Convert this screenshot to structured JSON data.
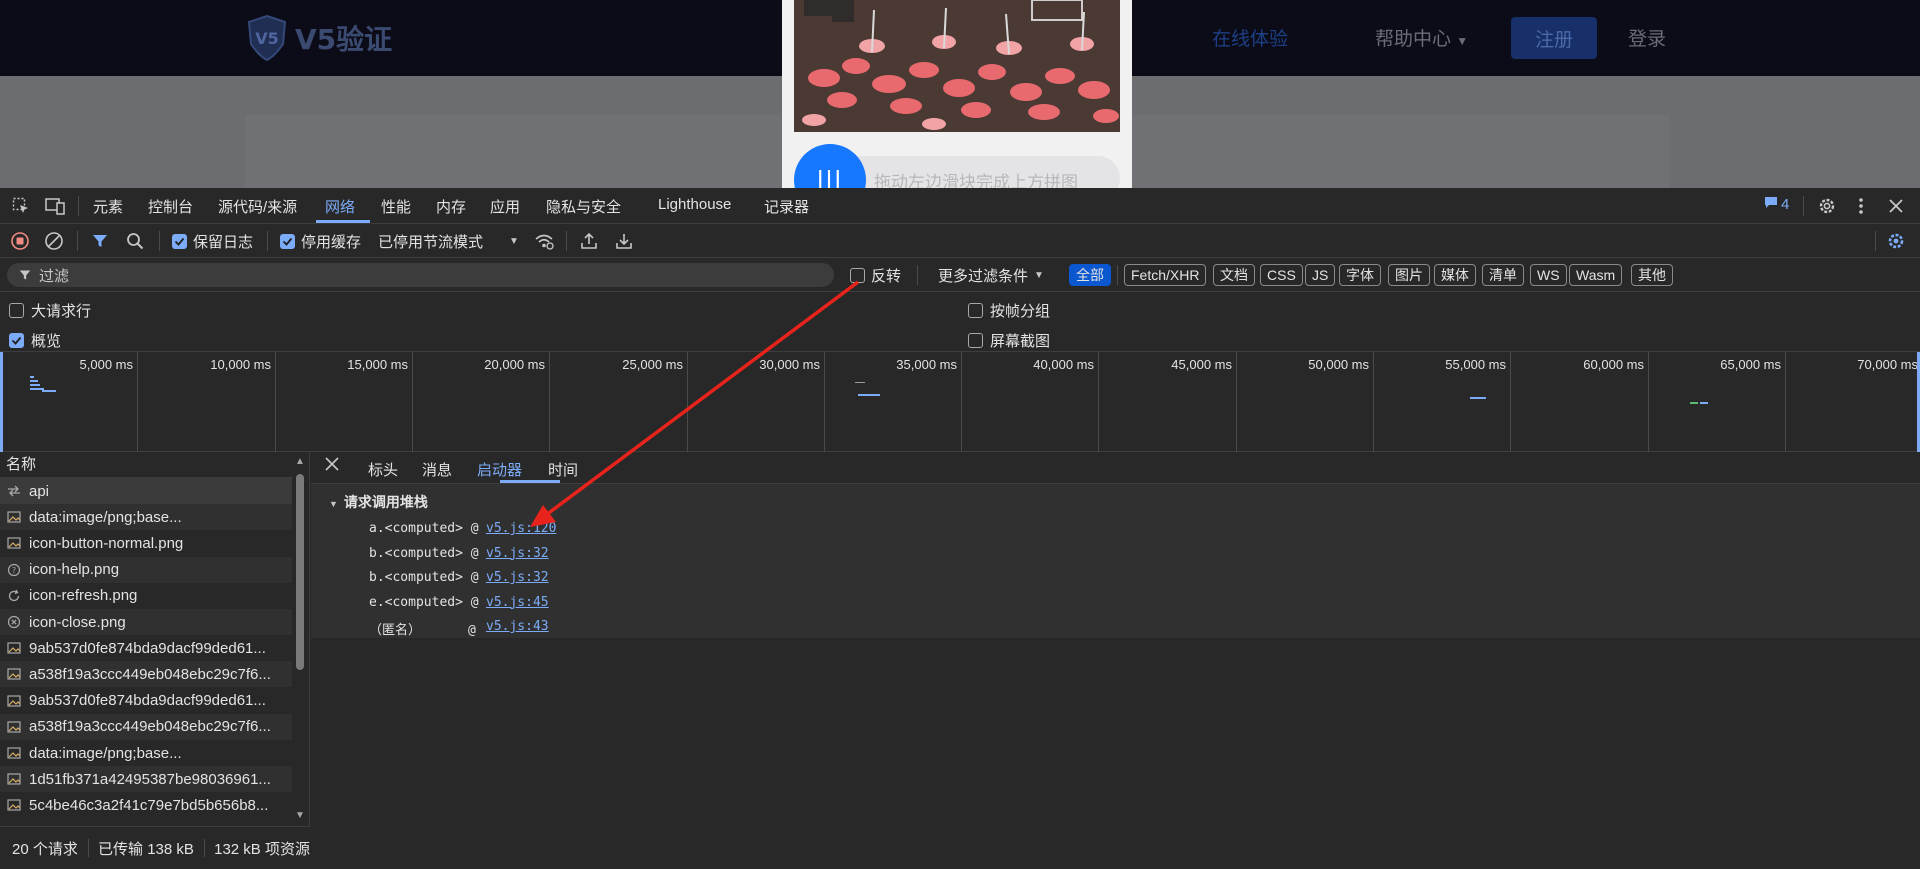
{
  "site": {
    "logo_text": "V5验证",
    "nav": {
      "trial": "在线体验",
      "help": "帮助中心",
      "register": "注册",
      "login": "登录"
    },
    "captcha": {
      "hint": "拖动左边滑块完成上方拼图",
      "knob": "|||"
    }
  },
  "devtools": {
    "tabs": [
      "元素",
      "控制台",
      "源代码/来源",
      "网络",
      "性能",
      "内存",
      "应用",
      "隐私与安全",
      "Lighthouse",
      "记录器"
    ],
    "active_tab": "网络",
    "issues_count": "4",
    "toolbar": {
      "preserve_log": "保留日志",
      "disable_cache": "停用缓存",
      "throttle": "已停用节流模式"
    },
    "filter": {
      "placeholder": "过滤",
      "invert": "反转",
      "more_filters": "更多过滤条件",
      "types": [
        "全部",
        "Fetch/XHR",
        "文档",
        "CSS",
        "JS",
        "字体",
        "图片",
        "媒体",
        "清单",
        "WS",
        "Wasm",
        "其他"
      ]
    },
    "options": {
      "large_rows": "大请求行",
      "group_by_frame": "按帧分组",
      "overview": "概览",
      "screenshots": "屏幕截图"
    },
    "overview_ticks": [
      "5,000 ms",
      "10,000 ms",
      "15,000 ms",
      "20,000 ms",
      "25,000 ms",
      "30,000 ms",
      "35,000 ms",
      "40,000 ms",
      "45,000 ms",
      "50,000 ms",
      "55,000 ms",
      "60,000 ms",
      "65,000 ms",
      "70,000 ms"
    ],
    "request_list": {
      "header": "名称",
      "rows": [
        {
          "name": "api",
          "icon": "fetch-icon"
        },
        {
          "name": "data:image/png;base...",
          "icon": "image-icon"
        },
        {
          "name": "icon-button-normal.png",
          "icon": "image-icon"
        },
        {
          "name": "icon-help.png",
          "icon": "help-icon"
        },
        {
          "name": "icon-refresh.png",
          "icon": "refresh-icon"
        },
        {
          "name": "icon-close.png",
          "icon": "close-icon"
        },
        {
          "name": "9ab537d0fe874bda9dacf99ded61...",
          "icon": "image-icon"
        },
        {
          "name": "a538f19a3ccc449eb048ebc29c7f6...",
          "icon": "image-icon"
        },
        {
          "name": "9ab537d0fe874bda9dacf99ded61...",
          "icon": "image-icon"
        },
        {
          "name": "a538f19a3ccc449eb048ebc29c7f6...",
          "icon": "image-icon"
        },
        {
          "name": "data:image/png;base...",
          "icon": "image-icon"
        },
        {
          "name": "1d51fb371a42495387be98036961...",
          "icon": "image-icon"
        },
        {
          "name": "5c4be46c3a2f41c79e7bd5b656b8...",
          "icon": "image-icon"
        }
      ]
    },
    "detail": {
      "tabs": [
        "标头",
        "消息",
        "启动器",
        "时间"
      ],
      "active_tab": "启动器",
      "stack_title": "请求调用堆栈",
      "frames": [
        {
          "fn": "a.<computed> @",
          "src": "v5.js:120"
        },
        {
          "fn": "b.<computed> @",
          "src": "v5.js:32"
        },
        {
          "fn": "b.<computed> @",
          "src": "v5.js:32"
        },
        {
          "fn": "e.<computed> @",
          "src": "v5.js:45"
        },
        {
          "fn": "（匿名）      @",
          "src": "v5.js:43"
        }
      ]
    },
    "status": {
      "requests": "20 个请求",
      "transferred": "已传输 138 kB",
      "resources": "132 kB 项资源"
    }
  },
  "colors": {
    "accent": "#7cacf8",
    "arrow": "#e8231b",
    "captcha_knob": "#1677ff"
  }
}
